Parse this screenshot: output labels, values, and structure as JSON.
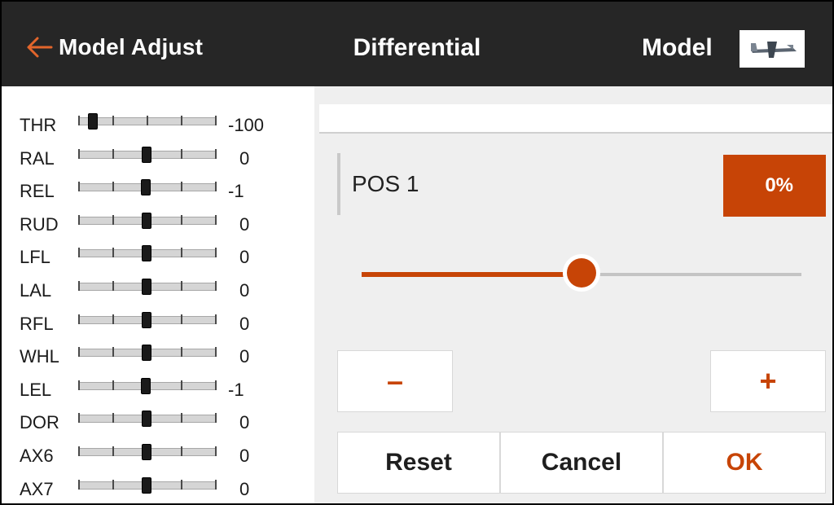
{
  "header": {
    "back_label": "Model Adjust",
    "title": "Differential",
    "model_label": "Model",
    "back_icon": "arrow-left-icon",
    "model_icon": "airplane-thumbnail-icon"
  },
  "channels": [
    {
      "name": "THR",
      "value": "-100",
      "level": -1.0
    },
    {
      "name": "RAL",
      "value": "0",
      "level": 0
    },
    {
      "name": "REL",
      "value": "-1",
      "level": -0.01
    },
    {
      "name": "RUD",
      "value": "0",
      "level": 0
    },
    {
      "name": "LFL",
      "value": "0",
      "level": 0
    },
    {
      "name": "LAL",
      "value": "0",
      "level": 0
    },
    {
      "name": "RFL",
      "value": "0",
      "level": 0
    },
    {
      "name": "WHL",
      "value": "0",
      "level": 0
    },
    {
      "name": "LEL",
      "value": "-1",
      "level": -0.01
    },
    {
      "name": "DOR",
      "value": "0",
      "level": 0
    },
    {
      "name": "AX6",
      "value": "0",
      "level": 0
    },
    {
      "name": "AX7",
      "value": "0",
      "level": 0
    }
  ],
  "editor": {
    "position_label": "POS 1",
    "value_text": "0%",
    "slider_fraction": 0.5,
    "minus_label": "–",
    "plus_label": "+",
    "reset_label": "Reset",
    "cancel_label": "Cancel",
    "ok_label": "OK"
  },
  "colors": {
    "accent": "#c74406",
    "header_bg": "#262626"
  }
}
